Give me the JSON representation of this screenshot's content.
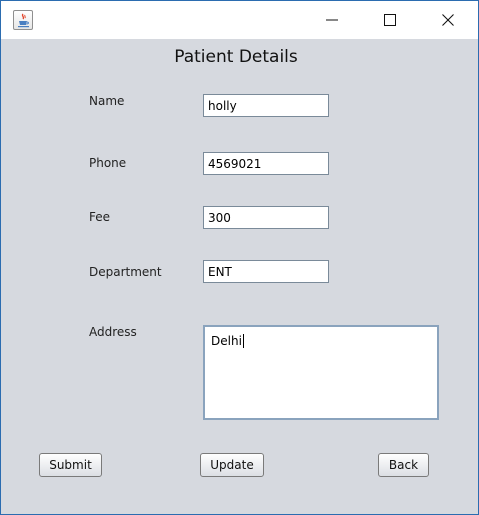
{
  "window": {
    "icon": "java-cup-icon",
    "controls": [
      "minimize-icon",
      "maximize-icon",
      "close-icon"
    ]
  },
  "form": {
    "title": "Patient Details",
    "fields": {
      "name": {
        "label": "Name",
        "value": "holly"
      },
      "phone": {
        "label": "Phone",
        "value": "4569021"
      },
      "fee": {
        "label": "Fee",
        "value": "300"
      },
      "department": {
        "label": "Department",
        "value": "ENT"
      },
      "address": {
        "label": "Address",
        "value": "Delhi"
      }
    }
  },
  "buttons": {
    "submit": "Submit",
    "update": "Update",
    "back": "Back"
  },
  "colors": {
    "background": "#d6d9df",
    "titlebar": "#ffffff",
    "border_accent": "#2b6cb0"
  }
}
